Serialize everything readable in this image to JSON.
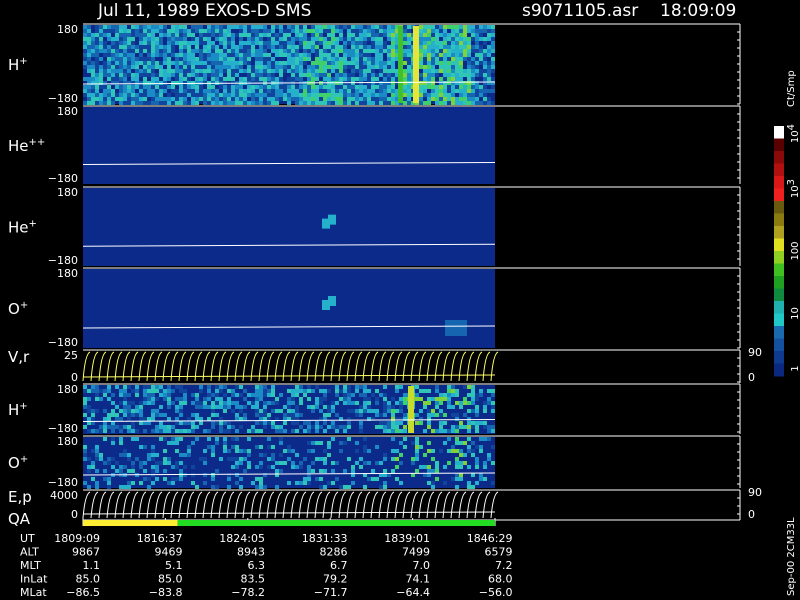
{
  "header": {
    "title": "Jul 11, 1989   EXOS-D SMS",
    "file": "s9071105.asr",
    "time": "18:09:09"
  },
  "colors": {
    "background": "#000000",
    "panel_background": "#0c2a8a",
    "trace": "#ffffff",
    "velocity_trace": "#ffff66",
    "qa_good": "#22dd22",
    "qa_marginal": "#ffee33"
  },
  "panels": [
    {
      "id": "h-plus-top",
      "label": "H",
      "sup": "+",
      "ymax": "180",
      "ymin": "−180"
    },
    {
      "id": "he-plus-plus",
      "label": "He",
      "sup": "++",
      "ymax": "180",
      "ymin": "−180"
    },
    {
      "id": "he-plus",
      "label": "He",
      "sup": "+",
      "ymax": "180",
      "ymin": "−180"
    },
    {
      "id": "o-plus-top",
      "label": "O",
      "sup": "+",
      "ymax": "180",
      "ymin": "−180"
    },
    {
      "id": "vr",
      "label": "V,r",
      "sup": "",
      "ymax": "25",
      "ymin": "0",
      "right_top": "90",
      "right_bottom": "0"
    },
    {
      "id": "h-plus-bottom",
      "label": "H",
      "sup": "+",
      "ymax": "180",
      "ymin": "−180"
    },
    {
      "id": "o-plus-bottom",
      "label": "O",
      "sup": "+",
      "ymax": "180",
      "ymin": "−180"
    },
    {
      "id": "ep",
      "label": "E,p",
      "sup": "",
      "ymax": "4000",
      "ymin": "0",
      "right_top": "90",
      "right_bottom": "0"
    }
  ],
  "qa": {
    "label": "QA",
    "marginal_fraction": 0.23
  },
  "colorbar": {
    "unit": "Ct/Smp",
    "ticks": [
      {
        "base": "10",
        "exp": "4"
      },
      {
        "base": "10",
        "exp": "3"
      },
      {
        "base": "100",
        "exp": ""
      },
      {
        "base": "10",
        "exp": ""
      },
      {
        "base": "1",
        "exp": ""
      }
    ]
  },
  "side_label": "Sep-00 2CM33L",
  "ephemeris": {
    "rows": [
      {
        "name": "UT",
        "values": [
          "1809:09",
          "1816:37",
          "1824:05",
          "1831:33",
          "1839:01",
          "1846:29"
        ]
      },
      {
        "name": "ALT",
        "values": [
          "9867",
          "9469",
          "8943",
          "8286",
          "7499",
          "6579"
        ]
      },
      {
        "name": "MLT",
        "values": [
          "1.1",
          "5.1",
          "6.3",
          "6.7",
          "7.0",
          "7.2"
        ]
      },
      {
        "name": "InLat",
        "values": [
          "85.0",
          "85.0",
          "83.5",
          "79.2",
          "74.1",
          "68.0"
        ]
      },
      {
        "name": "MLat",
        "values": [
          "−86.5",
          "−83.8",
          "−78.2",
          "−71.7",
          "−64.4",
          "−56.0"
        ]
      }
    ]
  },
  "chart_data": {
    "type": "heatmap",
    "x_label": "UT",
    "x_ticks": [
      "1809:09",
      "1816:37",
      "1824:05",
      "1831:33",
      "1839:01",
      "1846:29"
    ],
    "color_scale": {
      "unit": "Ct/Smp",
      "min": 1,
      "max": 10000,
      "log": true
    },
    "series": [
      {
        "name": "H+",
        "ylim": [
          -180,
          180
        ]
      },
      {
        "name": "He++",
        "ylim": [
          -180,
          180
        ]
      },
      {
        "name": "He+",
        "ylim": [
          -180,
          180
        ]
      },
      {
        "name": "O+",
        "ylim": [
          -180,
          180
        ]
      },
      {
        "name": "V,r",
        "ylim": [
          0,
          25
        ],
        "right_ylim": [
          0,
          90
        ]
      },
      {
        "name": "H+",
        "ylim": [
          -180,
          180
        ]
      },
      {
        "name": "O+",
        "ylim": [
          -180,
          180
        ]
      },
      {
        "name": "E,p",
        "ylim": [
          0,
          4000
        ],
        "right_ylim": [
          0,
          90
        ]
      }
    ]
  }
}
